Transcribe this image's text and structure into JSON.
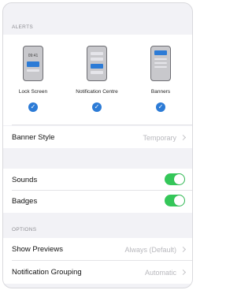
{
  "alerts": {
    "header": "ALERTS",
    "options": [
      {
        "label": "Lock Screen",
        "checked": true,
        "preview_time": "09:41"
      },
      {
        "label": "Notification Centre",
        "checked": true
      },
      {
        "label": "Banners",
        "checked": true
      }
    ],
    "check_glyph": "✓"
  },
  "banner_style": {
    "label": "Banner Style",
    "value": "Temporary"
  },
  "toggles": [
    {
      "label": "Sounds",
      "on": true
    },
    {
      "label": "Badges",
      "on": true
    }
  ],
  "options": {
    "header": "OPTIONS",
    "rows": [
      {
        "label": "Show Previews",
        "value": "Always (Default)"
      },
      {
        "label": "Notification Grouping",
        "value": "Automatic"
      }
    ]
  },
  "colors": {
    "toggle_on": "#34c759",
    "accent": "#2c7bd6"
  },
  "icons": [
    "checkmark-icon",
    "chevron-right-icon",
    "toggle-switch"
  ]
}
